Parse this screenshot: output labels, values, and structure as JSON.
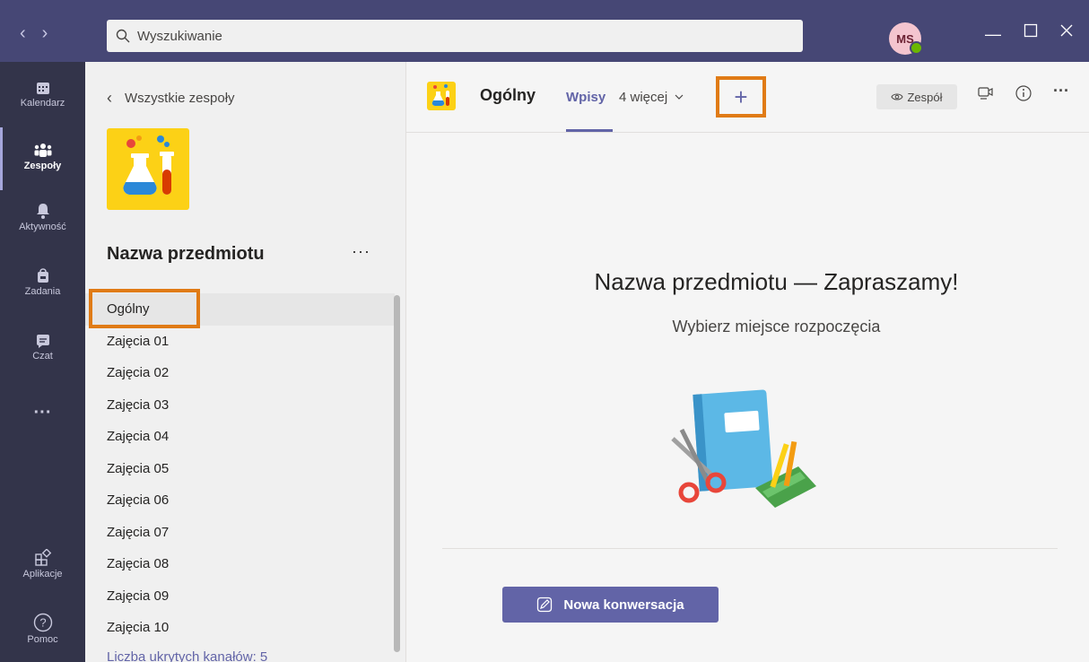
{
  "titlebar": {
    "search_placeholder": "Wyszukiwanie",
    "avatar_initials": "MS",
    "presence_status": "available"
  },
  "appbar": {
    "items": [
      {
        "label": "Kalendarz",
        "icon": "calendar-icon"
      },
      {
        "label": "Zespoły",
        "icon": "teams-icon",
        "active": true
      },
      {
        "label": "Aktywność",
        "icon": "bell-icon"
      },
      {
        "label": "Zadania",
        "icon": "bag-icon"
      },
      {
        "label": "Czat",
        "icon": "chat-icon"
      },
      {
        "label": "",
        "icon": "more-icon"
      },
      {
        "label": "Aplikacje",
        "icon": "apps-icon"
      },
      {
        "label": "Pomoc",
        "icon": "help-icon"
      }
    ]
  },
  "teampane": {
    "back_label": "Wszystkie zespoły",
    "team_name": "Nazwa przedmiotu",
    "more": "···",
    "channels": [
      "Ogólny",
      "Zajęcia 01",
      "Zajęcia 02",
      "Zajęcia 03",
      "Zajęcia 04",
      "Zajęcia 05",
      "Zajęcia 06",
      "Zajęcia 07",
      "Zajęcia 08",
      "Zajęcia 09",
      "Zajęcia 10"
    ],
    "selected_channel": "Ogólny",
    "hidden_channels_label": "Liczba ukrytych kanałów: 5"
  },
  "main": {
    "channel_title": "Ogólny",
    "tabs": {
      "posts": "Wpisy",
      "more": "4 więcej"
    },
    "add_tab": "+",
    "team_pill": "Zespół",
    "welcome_title": "Nazwa przedmiotu — Zapraszamy!",
    "welcome_subtitle": "Wybierz miejsce rozpoczęcia",
    "new_conversation": "Nowa konwersacja"
  },
  "colors": {
    "titlebar": "#464775",
    "appbar": "#33344a",
    "accent": "#6264a7",
    "highlight": "#e07b16",
    "team_logo": "#fcd116"
  }
}
